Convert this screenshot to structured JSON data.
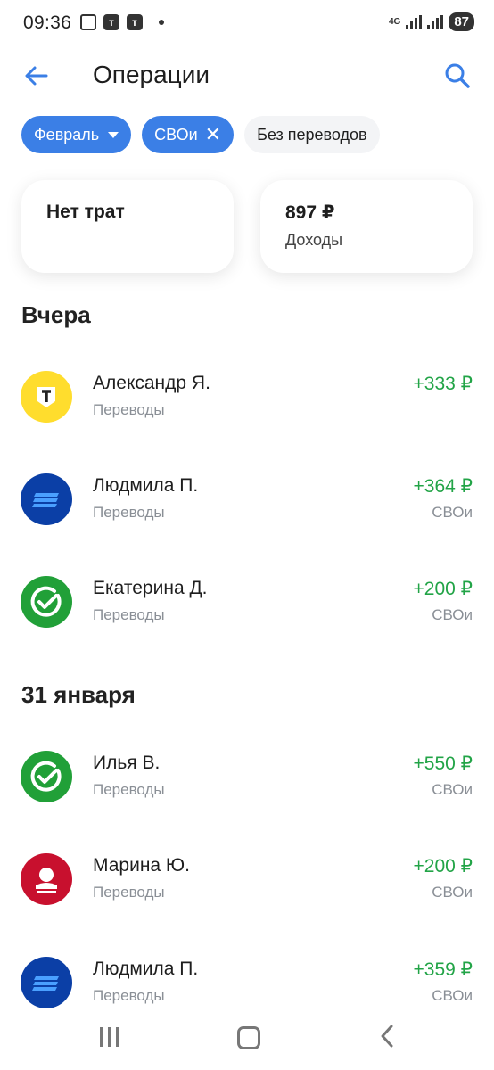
{
  "status_bar": {
    "time": "09:36",
    "network": "4G",
    "battery": "87"
  },
  "header": {
    "title": "Операции"
  },
  "chips": [
    {
      "label": "Февраль",
      "active": true,
      "icon": "caret-down-icon"
    },
    {
      "label": "СВОи",
      "active": true,
      "icon": "close-icon"
    },
    {
      "label": "Без переводов",
      "active": false
    }
  ],
  "summary": {
    "expenses": {
      "title": "Нет трат"
    },
    "income": {
      "amount": "897 ₽",
      "label": "Доходы"
    }
  },
  "sections": [
    {
      "title": "Вчера",
      "items": [
        {
          "name": "Александр Я.",
          "category": "Переводы",
          "amount": "+333 ₽",
          "bank": "",
          "avatar": "tbank-logo"
        },
        {
          "name": "Людмила П.",
          "category": "Переводы",
          "amount": "+364 ₽",
          "bank": "СВОи",
          "avatar": "vtb-logo"
        },
        {
          "name": "Екатерина Д.",
          "category": "Переводы",
          "amount": "+200 ₽",
          "bank": "СВОи",
          "avatar": "sber-logo"
        }
      ]
    },
    {
      "title": "31 января",
      "items": [
        {
          "name": "Илья В.",
          "category": "Переводы",
          "amount": "+550 ₽",
          "bank": "СВОи",
          "avatar": "sber-logo"
        },
        {
          "name": "Марина Ю.",
          "category": "Переводы",
          "amount": "+200 ₽",
          "bank": "СВОи",
          "avatar": "alfa-logo"
        },
        {
          "name": "Людмила П.",
          "category": "Переводы",
          "amount": "+359 ₽",
          "bank": "СВОи",
          "avatar": "vtb-logo"
        }
      ]
    }
  ],
  "colors": {
    "accent": "#3b7fe6",
    "income": "#22a447",
    "muted": "#8a8f96"
  }
}
